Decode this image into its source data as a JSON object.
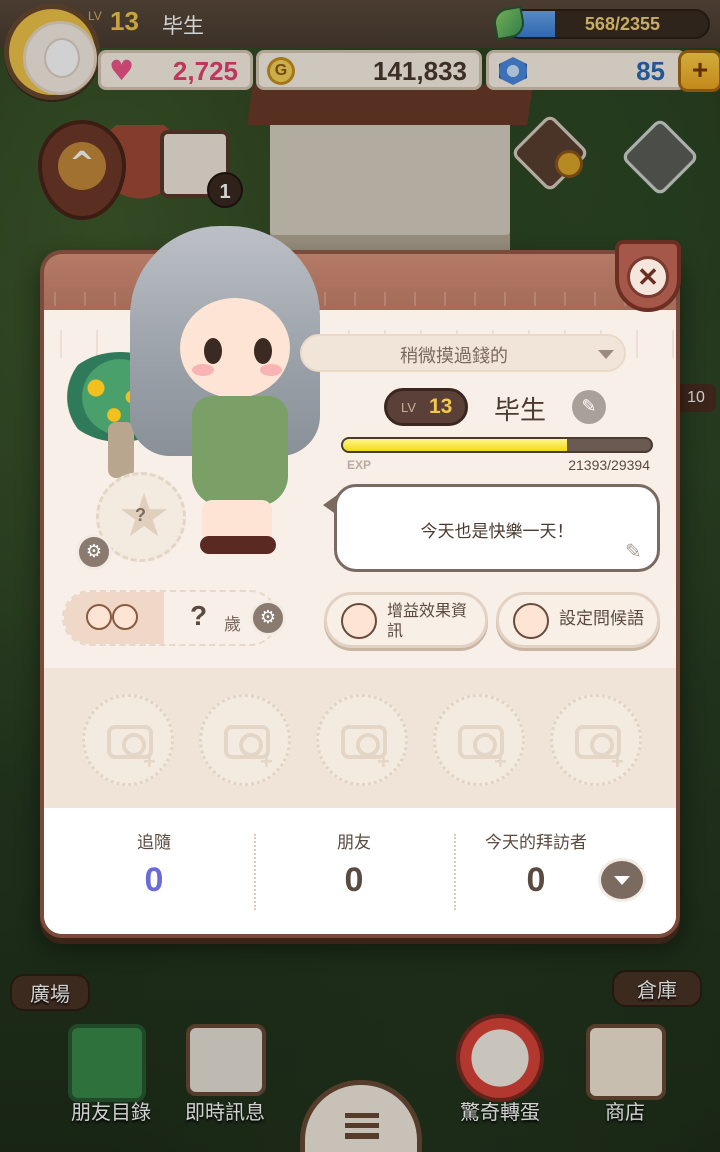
{
  "hud": {
    "level_prefix": "LV",
    "level": "13",
    "player_name": "毕生",
    "xp_text": "568/2355",
    "xp_fraction": 0.241,
    "hearts": "2,725",
    "coins": "141,833",
    "gems": "85",
    "plus_symbol": "+",
    "coin_glyph": "G"
  },
  "scene": {
    "calendar_badge": "1",
    "side_badge": "10"
  },
  "profile": {
    "title_select": "稍微摸過錢的",
    "level_prefix": "LV",
    "level": "13",
    "name": "毕生",
    "exp_label": "EXP",
    "exp_text": "21393/29394",
    "exp_fraction": 0.728,
    "greeting": "今天也是快樂一天！",
    "pet_unknown": "?",
    "age_value": "?",
    "age_unit": "歲",
    "buff_button": "增益效果資訊",
    "greeting_button": "設定問候語",
    "close_symbol": "✕",
    "photo_slots": 5
  },
  "stats": {
    "follow_label": "追隨",
    "follow_value": "0",
    "friends_label": "朋友",
    "friends_value": "0",
    "visitors_label": "今天的拜訪者",
    "visitors_value": "0"
  },
  "nav": {
    "plaza": "廣場",
    "warehouse": "倉庫",
    "friend_list": "朋友目錄",
    "messages": "即時訊息",
    "gacha": "驚奇轉蛋",
    "shop": "商店"
  },
  "icons": {
    "heart": "heart-icon",
    "coin": "coin-icon",
    "gem": "gem-icon",
    "leaf": "leaf-icon",
    "camera": "camera-icon",
    "gear": "gear-icon",
    "pencil": "pencil-icon"
  },
  "colors": {
    "panel_frame": "#7b4a3a",
    "hearts_text": "#e8436f",
    "gems_text": "#2a6ab8",
    "follow_value": "#6a6ad8",
    "level_gold": "#f4c84e"
  }
}
